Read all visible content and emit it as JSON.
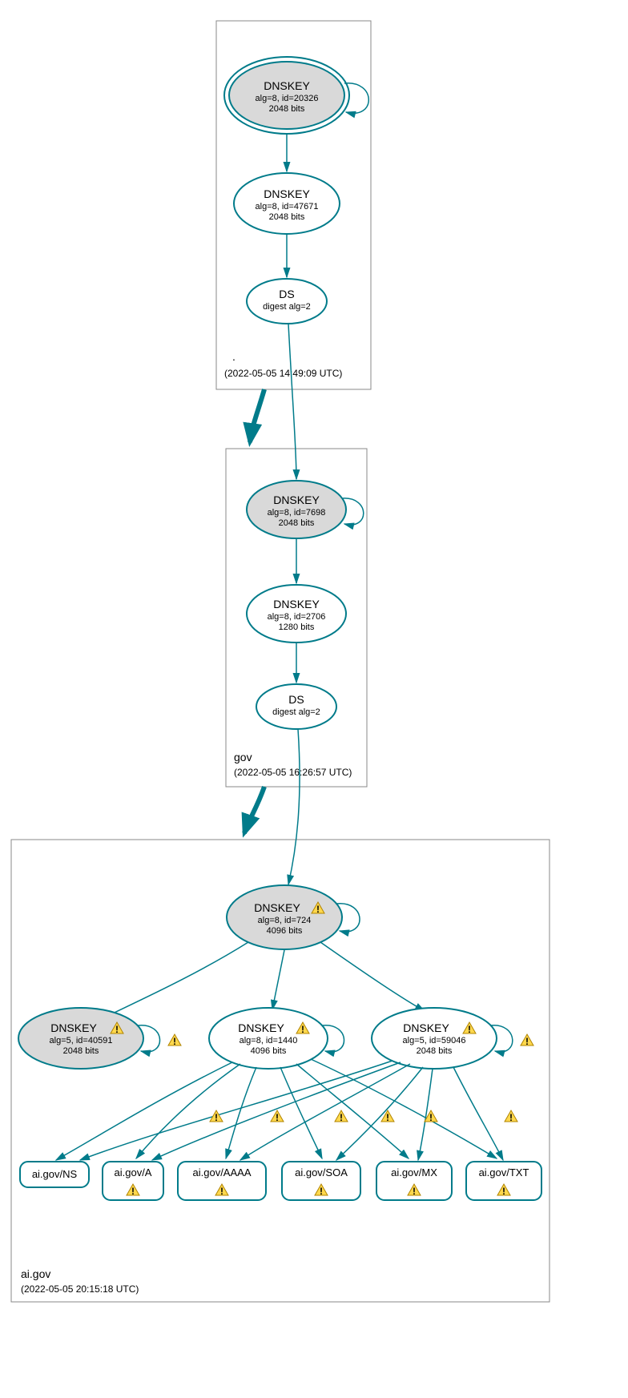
{
  "colors": {
    "accent": "#007b8a",
    "filled": "#d9d9d9",
    "warn": "#ffd84d"
  },
  "zones": {
    "root": {
      "label": ".",
      "timestamp": "(2022-05-05 14:49:09 UTC)"
    },
    "gov": {
      "label": "gov",
      "timestamp": "(2022-05-05 16:26:57 UTC)"
    },
    "aigov": {
      "label": "ai.gov",
      "timestamp": "(2022-05-05 20:15:18 UTC)"
    }
  },
  "nodes": {
    "root_ksk": {
      "title": "DNSKEY",
      "line1": "alg=8, id=20326",
      "line2": "2048 bits"
    },
    "root_zsk": {
      "title": "DNSKEY",
      "line1": "alg=8, id=47671",
      "line2": "2048 bits"
    },
    "root_ds": {
      "title": "DS",
      "line1": "digest alg=2"
    },
    "gov_ksk": {
      "title": "DNSKEY",
      "line1": "alg=8, id=7698",
      "line2": "2048 bits"
    },
    "gov_zsk": {
      "title": "DNSKEY",
      "line1": "alg=8, id=2706",
      "line2": "1280 bits"
    },
    "gov_ds": {
      "title": "DS",
      "line1": "digest alg=2"
    },
    "ai_ksk": {
      "title": "DNSKEY",
      "line1": "alg=8, id=724",
      "line2": "4096 bits"
    },
    "ai_k1": {
      "title": "DNSKEY",
      "line1": "alg=5, id=40591",
      "line2": "2048 bits"
    },
    "ai_k2": {
      "title": "DNSKEY",
      "line1": "alg=8, id=1440",
      "line2": "4096 bits"
    },
    "ai_k3": {
      "title": "DNSKEY",
      "line1": "alg=5, id=59046",
      "line2": "2048 bits"
    },
    "rr_ns": {
      "label": "ai.gov/NS"
    },
    "rr_a": {
      "label": "ai.gov/A"
    },
    "rr_aaaa": {
      "label": "ai.gov/AAAA"
    },
    "rr_soa": {
      "label": "ai.gov/SOA"
    },
    "rr_mx": {
      "label": "ai.gov/MX"
    },
    "rr_txt": {
      "label": "ai.gov/TXT"
    }
  }
}
